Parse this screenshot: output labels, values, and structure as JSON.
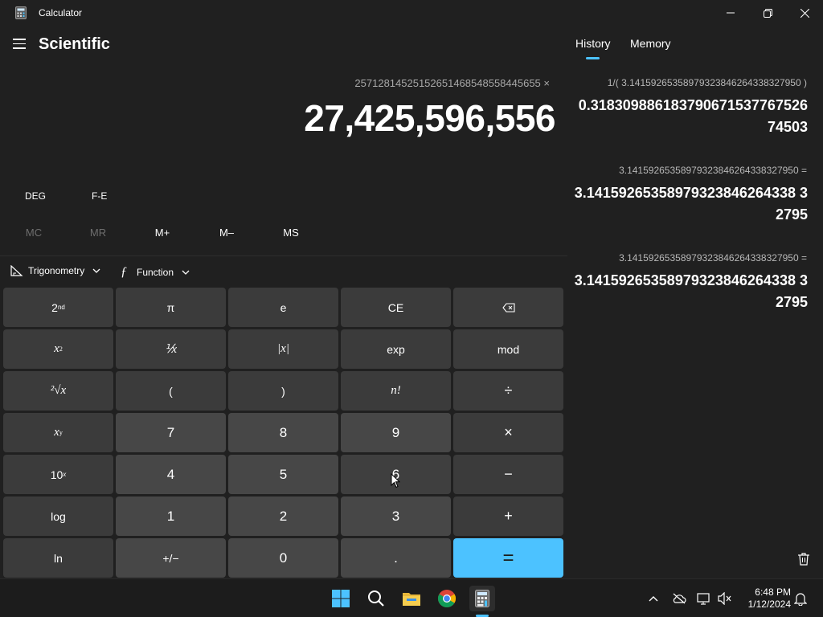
{
  "window": {
    "title": "Calculator",
    "mode": "Scientific"
  },
  "display": {
    "expression": "2571281452515265146854855844565​5 ×",
    "result": "27,425,596,556"
  },
  "toggles": {
    "angle": "DEG",
    "fe": "F-E"
  },
  "memory": {
    "mc": "MC",
    "mr": "MR",
    "mplus": "M+",
    "mminus": "M–",
    "ms": "MS"
  },
  "dropdowns": {
    "trig": "Trigonometry",
    "func": "Function"
  },
  "keys": {
    "second": "2",
    "second_sup": "nd",
    "pi": "π",
    "e": "e",
    "ce": "CE",
    "backspace": "⌫",
    "x2": "x",
    "x2_sup": "2",
    "inv": "⅟x",
    "abs": "|x|",
    "exp": "exp",
    "mod": "mod",
    "root": "²√x",
    "lparen": "(",
    "rparen": ")",
    "fact": "n!",
    "div": "÷",
    "xy": "x",
    "xy_sup": "y",
    "seven": "7",
    "eight": "8",
    "nine": "9",
    "mul": "×",
    "ten": "10",
    "ten_sup": "x",
    "four": "4",
    "five": "5",
    "six": "6",
    "minus": "−",
    "log": "log",
    "one": "1",
    "two": "2",
    "three": "3",
    "plus": "+",
    "ln": "ln",
    "negate": "+/−",
    "zero": "0",
    "dot": ".",
    "equals": "="
  },
  "history": {
    "tabs": [
      "History",
      "Memory"
    ],
    "items": [
      {
        "expr": "1/( 3.14159265358979323846264338327950 )",
        "result": "0.318309886183790671537767526 74503"
      },
      {
        "expr": "3.14159265358979323846264338327950 =",
        "result": "3.14159265358979323846264338 32795"
      },
      {
        "expr": "3.14159265358979323846264338327950 =",
        "result": "3.14159265358979323846264338 32795"
      }
    ]
  },
  "taskbar": {
    "time": "6:48 PM",
    "date": "1/12/2024"
  },
  "colors": {
    "accent": "#4cc2ff",
    "background": "#202020",
    "key_number": "#474747",
    "key_function": "#3b3b3b"
  }
}
